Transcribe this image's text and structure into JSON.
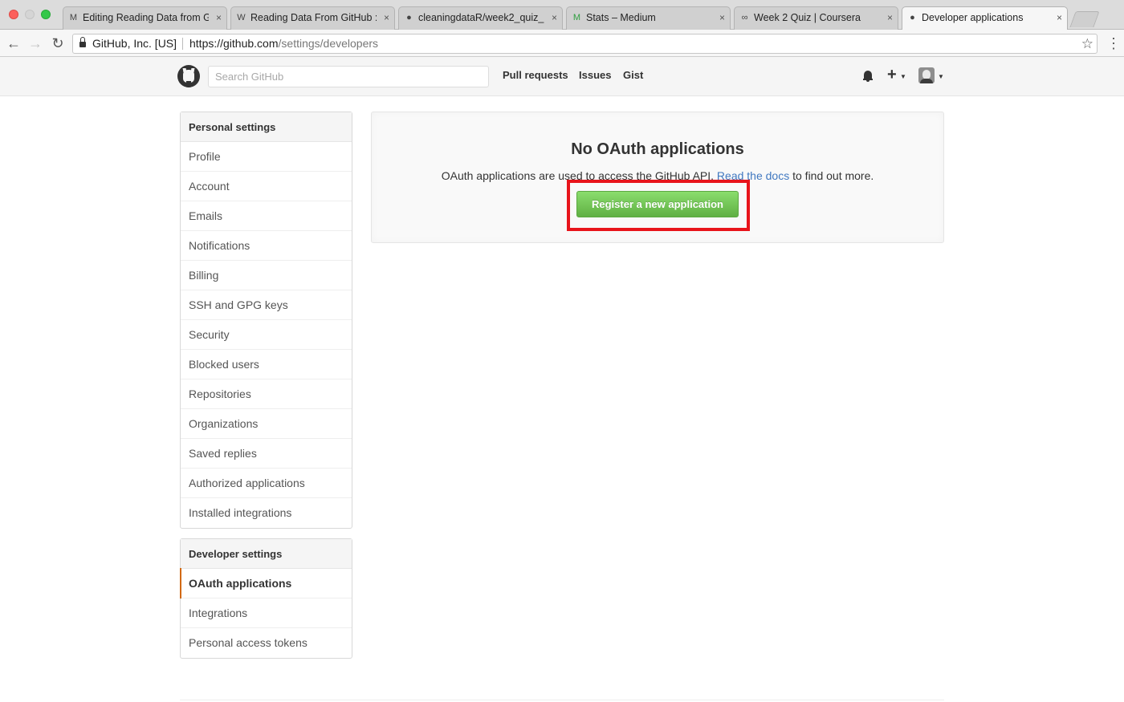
{
  "browser": {
    "tabs": [
      {
        "title": "Editing Reading Data from G",
        "icon": "medium-icon",
        "active": false
      },
      {
        "title": "Reading Data From GitHub :",
        "icon": "wordpress-icon",
        "active": false
      },
      {
        "title": "cleaningdataR/week2_quiz_",
        "icon": "github-icon",
        "active": false
      },
      {
        "title": "Stats – Medium",
        "icon": "medium-icon",
        "active": false
      },
      {
        "title": "Week 2 Quiz | Coursera",
        "icon": "coursera-icon",
        "active": false
      },
      {
        "title": "Developer applications",
        "icon": "github-icon",
        "active": true
      }
    ],
    "close_glyph": "×",
    "site_identity": "GitHub, Inc. [US]",
    "url_base": "https://github.com",
    "url_path": "/settings/developers",
    "back_glyph": "←",
    "forward_glyph": "→",
    "reload_glyph": "↻",
    "star_glyph": "☆",
    "menu_glyph": "⋮"
  },
  "header": {
    "search_placeholder": "Search GitHub",
    "nav": [
      "Pull requests",
      "Issues",
      "Gist"
    ],
    "plus_glyph": "+",
    "caret_glyph": "▼"
  },
  "sidebar": {
    "personal": {
      "heading": "Personal settings",
      "items": [
        "Profile",
        "Account",
        "Emails",
        "Notifications",
        "Billing",
        "SSH and GPG keys",
        "Security",
        "Blocked users",
        "Repositories",
        "Organizations",
        "Saved replies",
        "Authorized applications",
        "Installed integrations"
      ]
    },
    "developer": {
      "heading": "Developer settings",
      "items": [
        "OAuth applications",
        "Integrations",
        "Personal access tokens"
      ],
      "selected": "OAuth applications"
    }
  },
  "main": {
    "title": "No OAuth applications",
    "text_before": "OAuth applications are used to access the GitHub API. ",
    "docs_link": "Read the docs",
    "text_after": " to find out more.",
    "register_button": "Register a new application"
  },
  "colors": {
    "highlight": "#e8141b",
    "button_green": "#60b044",
    "link": "#4078c0",
    "selected_accent": "#d26911"
  }
}
